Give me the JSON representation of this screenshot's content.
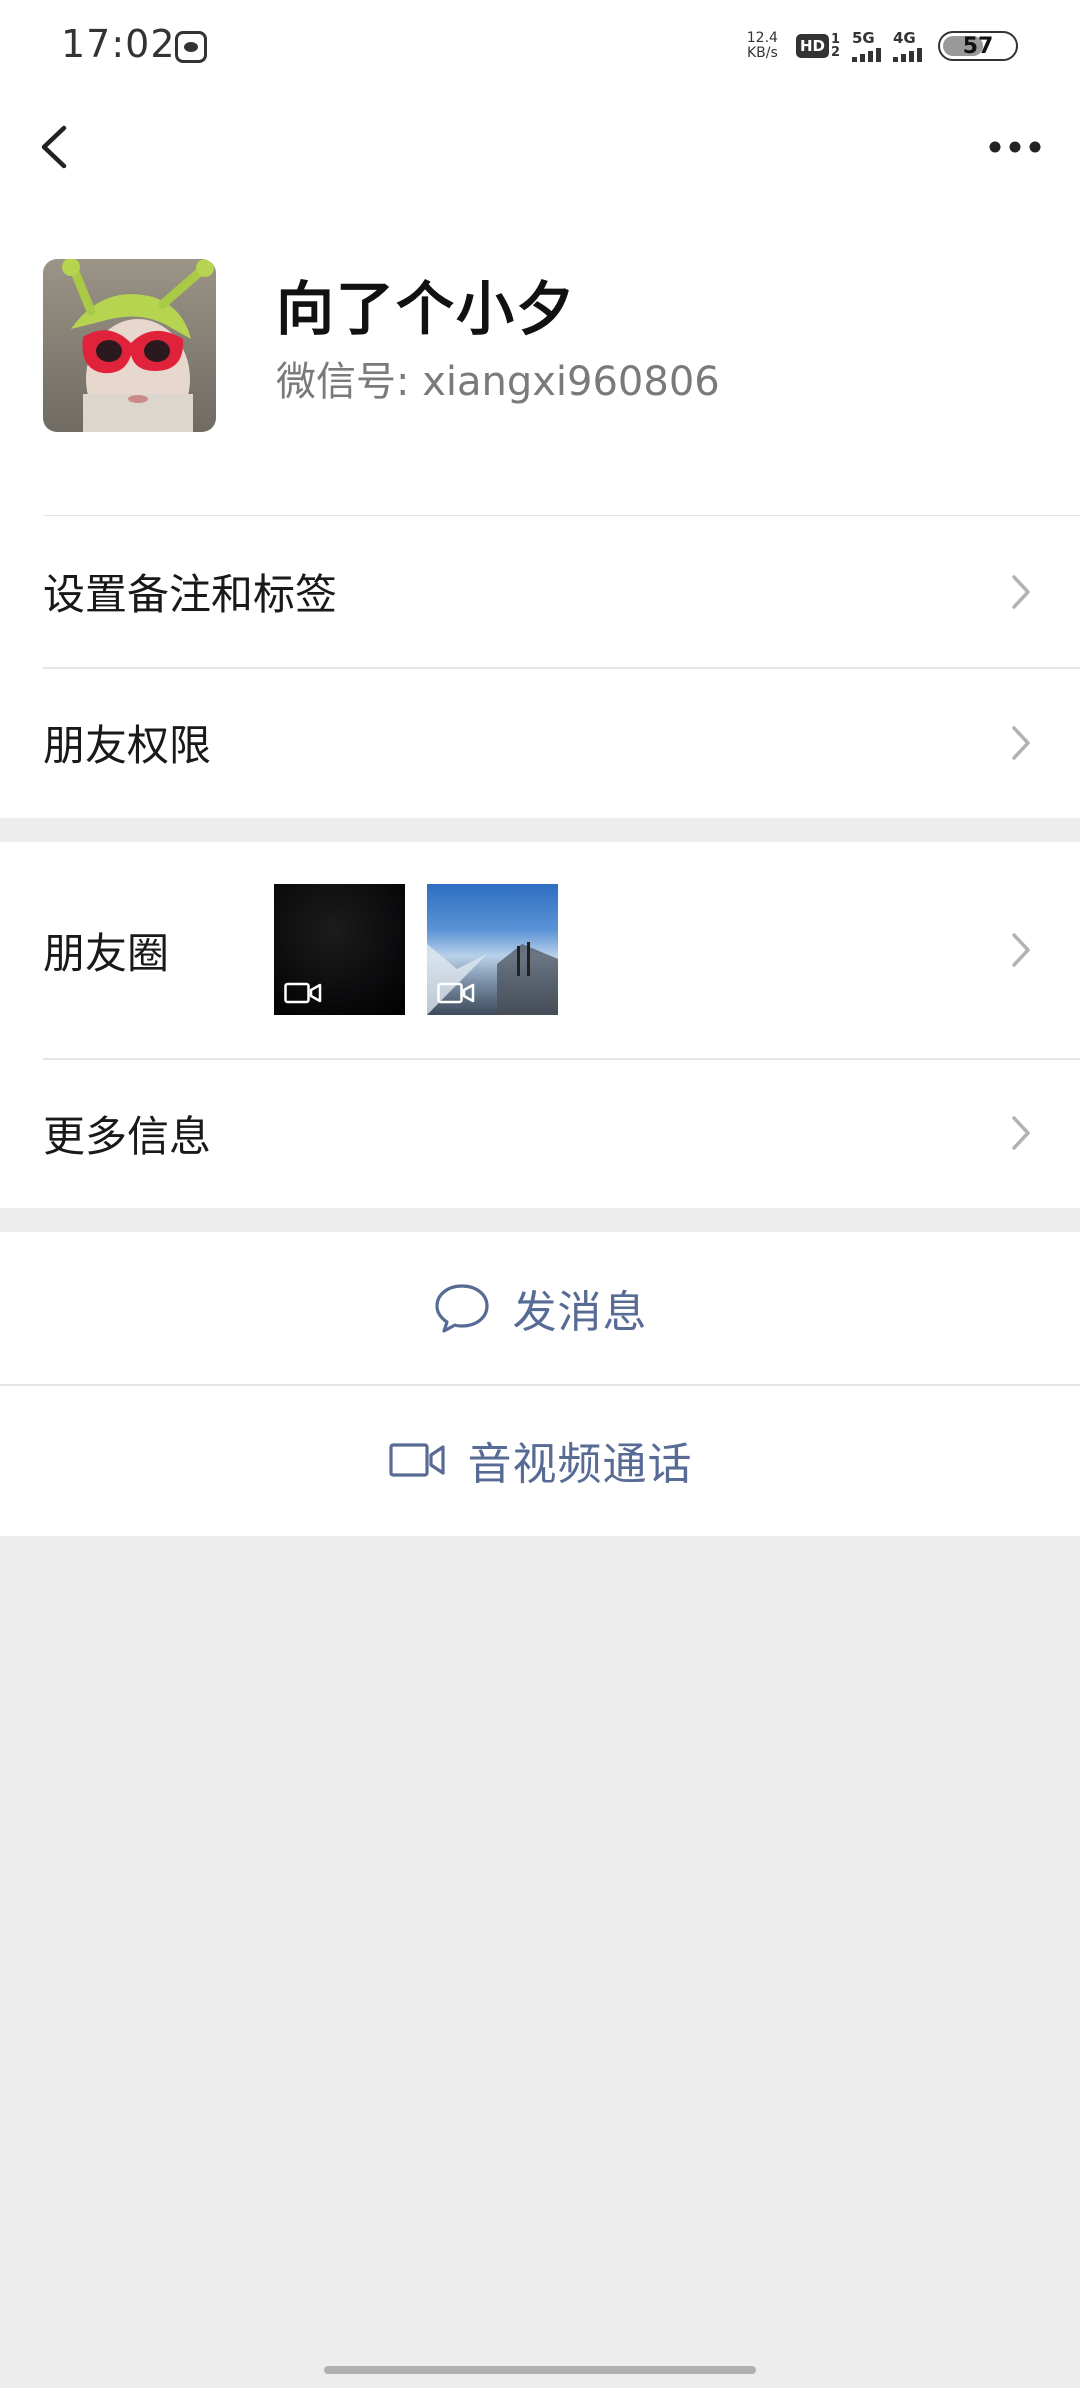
{
  "status": {
    "time": "17:02",
    "net_speed_value": "12.4",
    "net_speed_unit": "KB/s",
    "hd_label": "HD",
    "hd_nums": [
      "1",
      "2"
    ],
    "sim1_label": "5G",
    "sim2_label": "4G",
    "battery_level": "57"
  },
  "profile": {
    "nickname": "向了个小夕",
    "wechat_id_label": "微信号: ",
    "wechat_id": "xiangxi960806"
  },
  "menu": {
    "remarks_tags": "设置备注和标签",
    "friend_permissions": "朋友权限",
    "moments": "朋友圈",
    "more_info": "更多信息"
  },
  "actions": {
    "send_message": "发消息",
    "av_call": "音视频通话"
  },
  "colors": {
    "link": "#576b95",
    "background": "#ededed"
  }
}
